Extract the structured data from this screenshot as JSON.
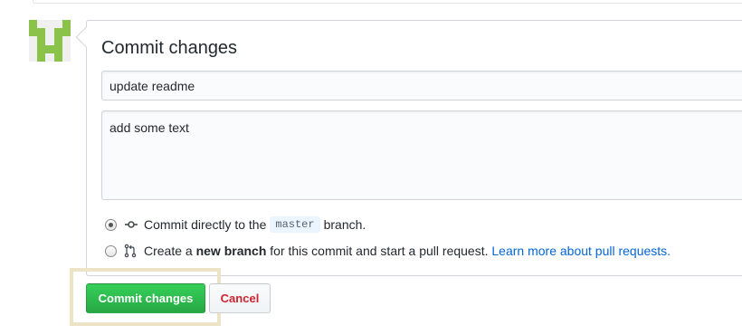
{
  "form": {
    "title": "Commit changes",
    "summary_value": "update readme",
    "description_value": "add some text"
  },
  "options": {
    "direct": {
      "prefix": "Commit directly to the",
      "branch": "master",
      "suffix": "branch.",
      "selected": true
    },
    "new_branch": {
      "prefix": "Create a",
      "bold": "new branch",
      "suffix": "for this commit and start a pull request.",
      "link": "Learn more about pull requests.",
      "selected": false
    }
  },
  "buttons": {
    "commit_label": "Commit changes",
    "cancel_label": "Cancel"
  },
  "colors": {
    "commit_button": "#28a745",
    "cancel_text": "#cb2431",
    "link": "#0366d6",
    "highlight": "#ece4c4",
    "avatar": "#8bc34a"
  },
  "icons": {
    "commit": "git-commit-icon",
    "pull_request": "git-pull-request-icon"
  }
}
